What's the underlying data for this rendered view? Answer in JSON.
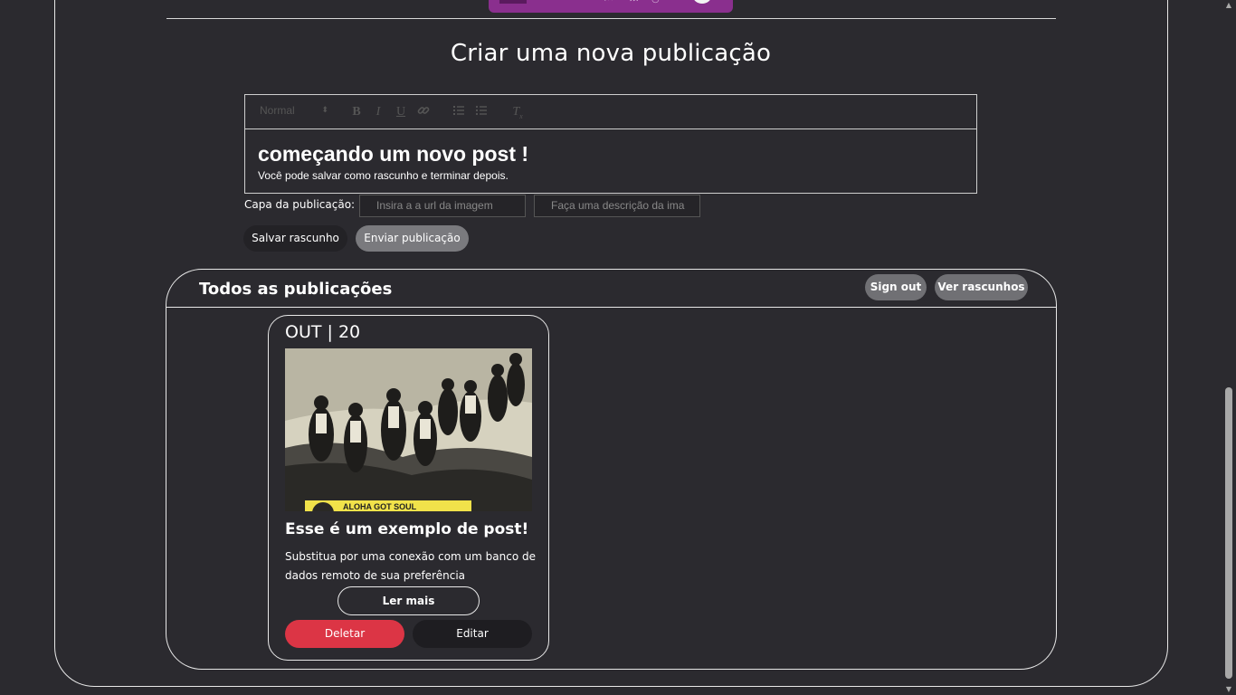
{
  "page": {
    "title": "Criar uma nova publicação"
  },
  "editor": {
    "toolbar": {
      "format_select": "Normal",
      "bold": "B",
      "italic": "I",
      "underline": "U",
      "link_icon": "link-icon",
      "ordered_list_icon": "ordered-list-icon",
      "bullet_list_icon": "bullet-list-icon",
      "clear_format_icon": "clear-format-icon"
    },
    "heading": "começando um novo post !",
    "body": "Você pode salvar como rascunho e terminar depois."
  },
  "cover": {
    "label": "Capa da publicação:",
    "url_placeholder": "Insira a a url da imagem",
    "desc_placeholder": "Faça uma descrição da ima"
  },
  "actions": {
    "save_draft": "Salvar rascunho",
    "send": "Enviar publicação"
  },
  "posts_panel": {
    "title": "Todos as publicações",
    "sign_out": "Sign out",
    "view_drafts": "Ver rascunhos"
  },
  "posts": [
    {
      "date": "OUT | 20",
      "image_caption": "ALOHA GOT SOUL",
      "title": "Esse é um exemplo de post!",
      "description": "Substitua por uma conexão com um banco de dados remoto de sua preferência",
      "read_more": "Ler mais",
      "delete": "Deletar",
      "edit": "Editar"
    }
  ],
  "colors": {
    "background": "#2b2a2f",
    "border": "#e8e8e8",
    "delete": "#dc3545",
    "pill": "#707074",
    "player": "#8a2f8e"
  }
}
